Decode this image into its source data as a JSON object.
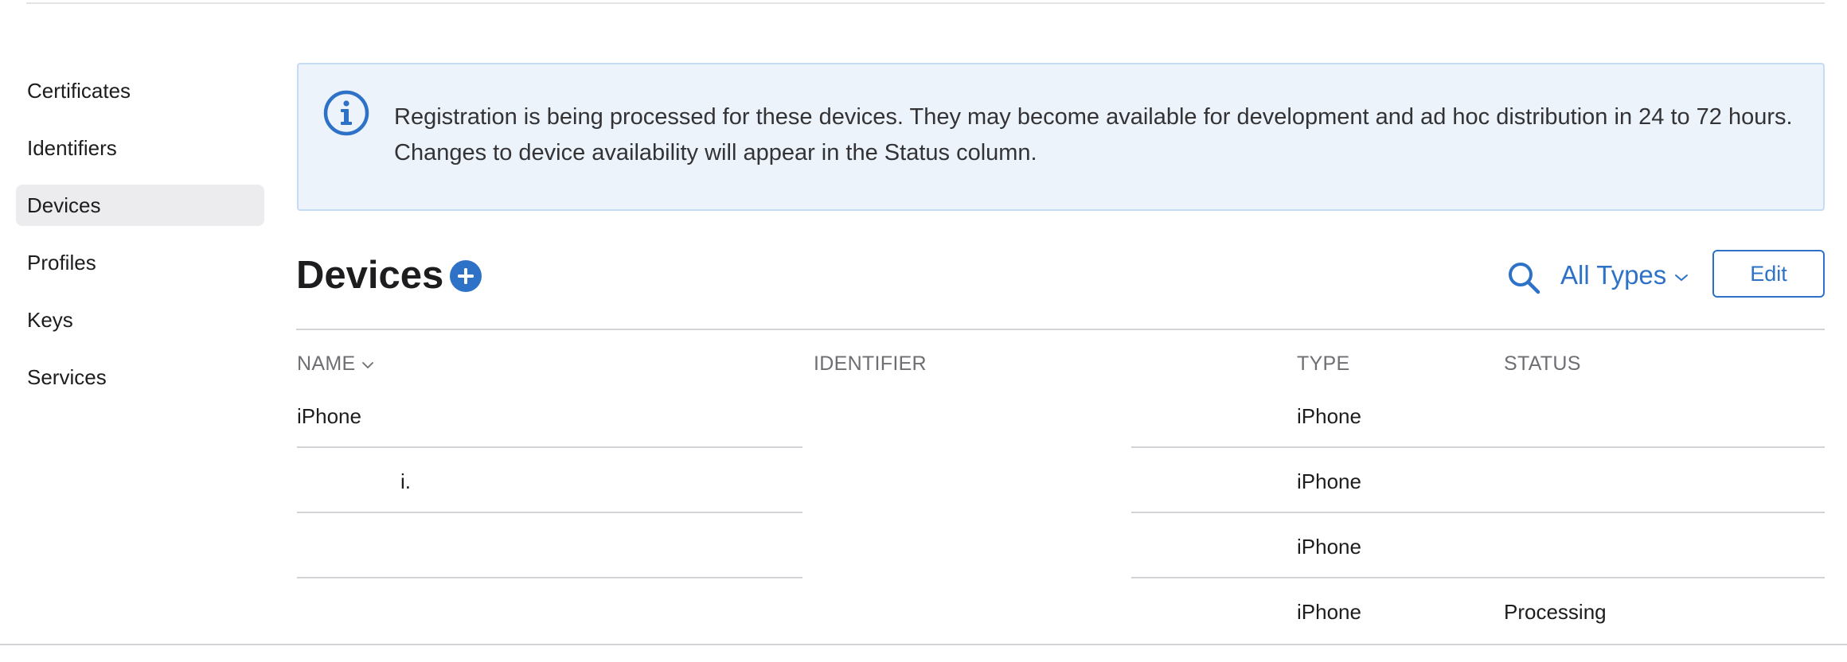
{
  "sidebar": {
    "items": [
      {
        "label": "Certificates",
        "active": false
      },
      {
        "label": "Identifiers",
        "active": false
      },
      {
        "label": "Devices",
        "active": true
      },
      {
        "label": "Profiles",
        "active": false
      },
      {
        "label": "Keys",
        "active": false
      },
      {
        "label": "Services",
        "active": false
      }
    ]
  },
  "banner": {
    "icon": "info-circle-icon",
    "text": "Registration is being processed for these devices. They may become available for development and ad hoc distribution in 24 to 72 hours. Changes to device availability will appear in the Status column."
  },
  "header": {
    "title": "Devices",
    "add_icon": "plus-circle-icon",
    "search_icon": "search-icon",
    "filter_label": "All Types",
    "edit_label": "Edit"
  },
  "table": {
    "columns": {
      "name": "NAME",
      "identifier": "IDENTIFIER",
      "type": "TYPE",
      "status": "STATUS"
    },
    "rows": [
      {
        "name": "iPhone",
        "identifier": "",
        "type": "iPhone",
        "status": ""
      },
      {
        "name": "i.",
        "identifier": "",
        "type": "iPhone",
        "status": ""
      },
      {
        "name": "",
        "identifier": "",
        "type": "iPhone",
        "status": ""
      },
      {
        "name": "",
        "identifier": "",
        "type": "iPhone",
        "status": "Processing"
      }
    ]
  },
  "colors": {
    "accent": "#2e72c7",
    "banner_bg": "#edf3fb",
    "banner_border": "#c6dcf4",
    "sidebar_active_bg": "#ececee"
  }
}
